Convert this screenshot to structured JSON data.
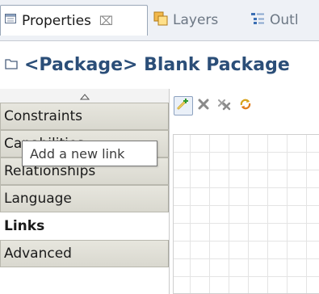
{
  "tabs": [
    {
      "label": "Properties",
      "icon": "properties-icon",
      "close": "⌧",
      "active": true
    },
    {
      "label": "Layers",
      "icon": "layers-icon",
      "active": false
    },
    {
      "label": "Outl",
      "icon": "outline-icon",
      "active": false
    }
  ],
  "header": {
    "title": "<Package> Blank Package",
    "icon": "package-icon"
  },
  "sidebar": {
    "scroll_icon": "scroll-up-icon",
    "items": [
      {
        "label": "Constraints",
        "selected": false
      },
      {
        "label": "Capabilities",
        "selected": false
      },
      {
        "label": "Relationships",
        "selected": false
      },
      {
        "label": "Language",
        "selected": false
      },
      {
        "label": "Links",
        "selected": true
      },
      {
        "label": "Advanced",
        "selected": false
      }
    ]
  },
  "toolbar": {
    "buttons": [
      {
        "icon": "add-link-icon"
      },
      {
        "icon": "delete-icon"
      },
      {
        "icon": "delete-all-icon"
      },
      {
        "icon": "refresh-icon"
      }
    ]
  },
  "tooltip": {
    "text": "Add a new link"
  },
  "colors": {
    "title": "#2b4e78",
    "tab_bar": "#eef1f6",
    "category_bg": "#dedcd3"
  }
}
